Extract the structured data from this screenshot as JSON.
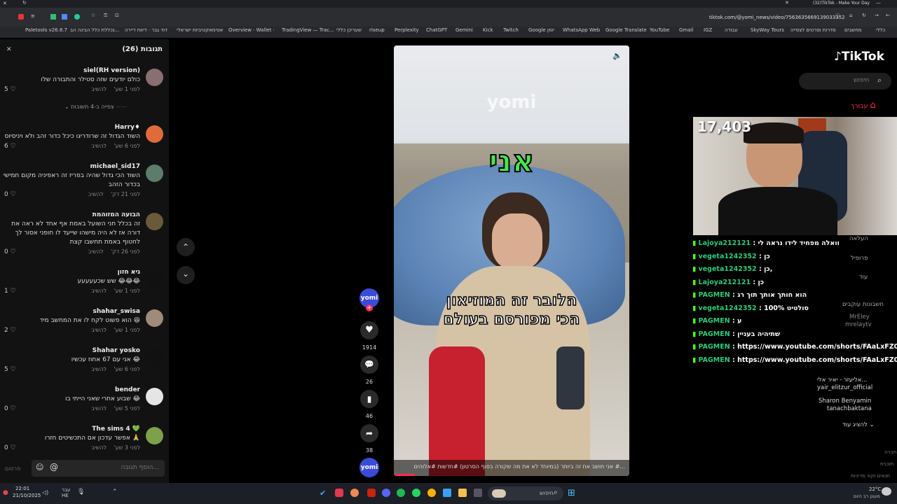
{
  "browser": {
    "tab_title": "(32)TikTok - Make Your Day",
    "url": "tiktok.com/@yomi_news/video/7563635669139033352",
    "bookmarks": [
      "Paletools v26.8.7",
      "נכללת כלל הבינה הב...",
      "דוד גבר · דיווח דיירה",
      "אטימאקטיביות ישראלי",
      "Overview · Wallet ·",
      "TradingView — Trac...",
      "שעריכן כללי",
      "riseup",
      "Perplexity",
      "ChatGPT",
      "Gemini",
      "Kick",
      "Twitch",
      "Google יומן",
      "WhatsApp Web",
      "Google Translate",
      "YouTube",
      "Gmail",
      "IGZ",
      "עבודה",
      "SkyWay Tours",
      "סדרות וסרטים לצפייה",
      "מחשבים",
      "כללי"
    ]
  },
  "comments": {
    "title": "תגובות (26)",
    "items": [
      {
        "name": "siel(RH version)",
        "text": "כולם יודעים שזה סטילר והתבורה שלו",
        "time": "לפני 1 שע'",
        "reply": "להשיב",
        "likes": "5"
      },
      {
        "name": "Harry♦",
        "text": "השוד הגדול זה שרודריגו כיכל כדור זהב ולא ויניסיוס",
        "time": "לפני 6 שע'",
        "reply": "להשיב",
        "likes": "6"
      },
      {
        "name": "michael_sid17",
        "text": "השוד הכי גדול שהיה בפריז זה ראפיניה מקום חמישי בכדור הזהב",
        "time": "לפני 21 דק'",
        "reply": "להשיב",
        "likes": "0"
      },
      {
        "name": "הבועה המזוהמת",
        "text": "זה בכלל חני השועל באמת אף אחד לא ראה את דורה אז לא היה מישהו שייעד לו חופני אסור לך לחטוף באמת תחשבו קצת",
        "time": "לפני 26 דק'",
        "reply": "להשיב",
        "likes": "0"
      },
      {
        "name": "גיא חזון",
        "text": "שש שכעעעעע 😂😂😂",
        "time": "לפני 1 שע'",
        "reply": "להשיב",
        "likes": "1"
      },
      {
        "name": "shahar_swisa",
        "text": "הוא פשוט לקח לו את המחשב מיד 😆",
        "time": "לפני 1 שע'",
        "reply": "להשיב",
        "likes": "2"
      },
      {
        "name": "Shahar yosko",
        "text": "אני עם 67 אחוז עכשיו 😂",
        "time": "לפני 6 שע'",
        "reply": "להשיב",
        "likes": "5"
      },
      {
        "name": "bender",
        "text": "שבוע אחרי שאני הייתי בו 😂",
        "time": "לפני 5 שע'",
        "reply": "להשיב",
        "likes": "0"
      },
      {
        "name": "The sims 4 💚",
        "text": "אפשר עדכון אם התכשיטים חזרו 🙏",
        "time": "לפני 3 שע'",
        "reply": "להשיב",
        "likes": "0"
      }
    ],
    "view_replies": "צפייה ב-4 תשובות",
    "input_placeholder": "הוסף תגובה...",
    "post": "פרסום"
  },
  "video": {
    "watermark": "yomi",
    "caption_top": "אני",
    "caption_line1": "הלובר זה המוזיאון",
    "caption_line2": "הכי מפורסם בעולם",
    "description": "אני חושב את זה ביותר (במיוחד לא את מה שקורה בסוף הסרטון) #חדשות #אלוהים #..."
  },
  "actions": {
    "account": "yomi",
    "likes": "1914",
    "comments": "26",
    "saves": "46",
    "shares": "38"
  },
  "sidebar": {
    "logo": "TikTok",
    "search_placeholder": "חיפוש",
    "foryou": "עבורך",
    "upload": "העלאה",
    "profile": "פרופיל",
    "more": "עוד",
    "following_title": "חשבונות עוקבים",
    "accounts": [
      {
        "name": "MrEley",
        "handle": "mrelaytv"
      },
      {
        "name": "אליעזר - יאיר אלי...",
        "handle": "yair_elitzur_official"
      },
      {
        "name": "Sharon Benyamin",
        "handle": "tanachbaktana"
      }
    ],
    "show_more": "להציג עוד",
    "footer": [
      "חברה",
      "תוכנית",
      "תנאים וקווי מדיניות"
    ]
  },
  "stream": {
    "viewers": "17,403"
  },
  "chat": [
    {
      "user": "Lajoya212121",
      "msg": "וואלה מפחיד לידו נראה לי"
    },
    {
      "user": "vegeta1242352",
      "msg": "כן"
    },
    {
      "user": "vegeta1242352",
      "msg": "כן,"
    },
    {
      "user": "Lajoya212121",
      "msg": "כן"
    },
    {
      "user": "PAGMEN",
      "msg": "הוא חותך אותך תוך רג"
    },
    {
      "user": "vegeta1242352",
      "msg": "סולטיט 100%"
    },
    {
      "user": "PAGMEN",
      "msg": "ע"
    },
    {
      "user": "PAGMEN",
      "msg": "שתיהיה בעניין"
    },
    {
      "user": "PAGMEN",
      "msg": "https://www.youtube.com/shorts/FAaLxFZ07P0"
    },
    {
      "user": "PAGMEN",
      "msg": "https://www.youtube.com/shorts/FAaLxFZ07P0"
    }
  ],
  "taskbar": {
    "time": "22:01",
    "date": "21/10/2025",
    "lang": "עבר\nHE",
    "search": "חיפוש",
    "weather_temp": "22°C",
    "weather_desc": "מעונן רב היום"
  },
  "colors": {
    "chat_user": "#2ecb7a",
    "kick_green": "#53fc18",
    "tiktok_red": "#fe2c55",
    "caption_green": "#46e64a"
  }
}
